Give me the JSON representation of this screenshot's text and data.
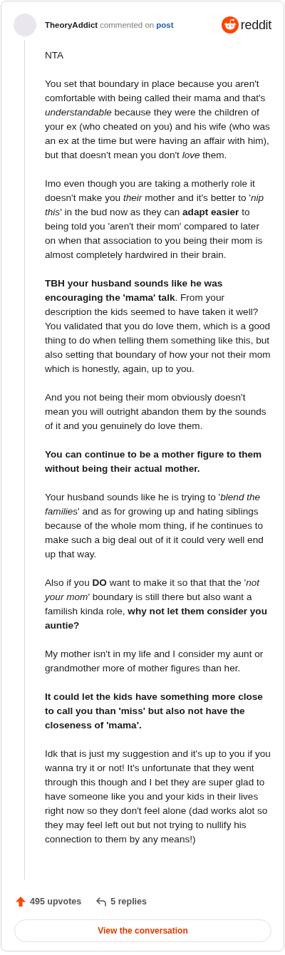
{
  "header": {
    "author": "TheoryAddict",
    "action": "commented on",
    "target": "post",
    "brand": "reddit"
  },
  "comment": {
    "paragraphs": [
      "NTA",
      "You set that boundary in place because you aren't comfortable with being called their mama and that's *understandable* because they were the children of your ex (who cheated on you) and his wife (who was an ex at the time but were having an affair with him), but that doesn't mean you don't *love* them.",
      "Imo even though you are taking a motherly role it doesn't make you *their* mother and it's better to '*nip this*' in the bud now as they can **adapt easier** to being told you 'aren't their mom' compared to later on when that association to you being their mom is almost completely hardwired in their brain.",
      "**TBH your husband sounds like he was encouraging the 'mama' talk**. From your description the kids seemed to have taken it well? You validated that you do love them, which is a good thing to do when telling them something like this, but also setting that boundary of how your not their mom which is honestly, again, up to you.",
      "And you not being their mom obviously doesn't mean you will outright abandon them by the sounds of it and you genuinely do love them.",
      "**You can continue to be a mother figure to them without being their actual mother.**",
      "Your husband sounds like he is trying to '*blend the families*' and as for growing up and hating siblings because of the whole mom thing, if he continues to make such a big deal out of it it could very well end up that way.",
      "Also if you **DO** want to make it so that that the '*not your mom*' boundary is still there but also want a familish kinda role, **why not let them consider you auntie?**",
      "My mother isn't in my life and I consider my aunt or grandmother more of mother figures than her.",
      "**It could let the kids have something more close to call you than 'miss' but also not have the closeness of 'mama'.**",
      "Idk that is just my suggestion and it's up to you if you wanna try it or not! It's unfortunate that they went through this though and I bet they are super glad to have someone like you and your kids in their lives right now so they don't feel alone (dad works alot so they may feel left out but not trying to nullify his connection to them by any means!)"
    ]
  },
  "footer": {
    "upvotes": "495 upvotes",
    "replies": "5 replies",
    "button": "View the conversation"
  }
}
